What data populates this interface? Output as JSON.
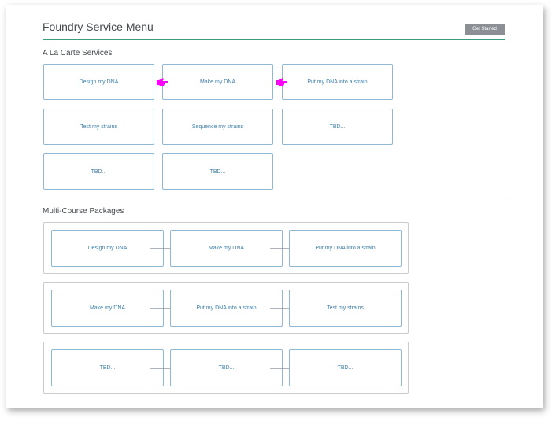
{
  "header": {
    "title": "Foundry Service Menu",
    "get_started_label": "Get Started"
  },
  "a_la_carte": {
    "heading": "A La Carte Services",
    "tiles": [
      "Design my DNA",
      "Make my DNA",
      "Put my DNA into a strain",
      "Test my strains",
      "Sequence my strains",
      "TBD...",
      "TBD...",
      "TBD..."
    ]
  },
  "packages": {
    "heading": "Multi-Course Packages",
    "rows": [
      [
        "Design my DNA",
        "Make my DNA",
        "Put my DNA into a strain"
      ],
      [
        "Make my DNA",
        "Put my DNA into a strain",
        "Test my strains"
      ],
      [
        "TBD...",
        "TBD...",
        "TBD..."
      ]
    ]
  },
  "colors": {
    "accent_rule": "#3c9a7e",
    "tile_text": "#3d7fa8",
    "pointer_icon": "#ff00ff"
  },
  "icons": {
    "pointer": "pointing-hand-icon",
    "arrow": "arrow-right-icon"
  }
}
